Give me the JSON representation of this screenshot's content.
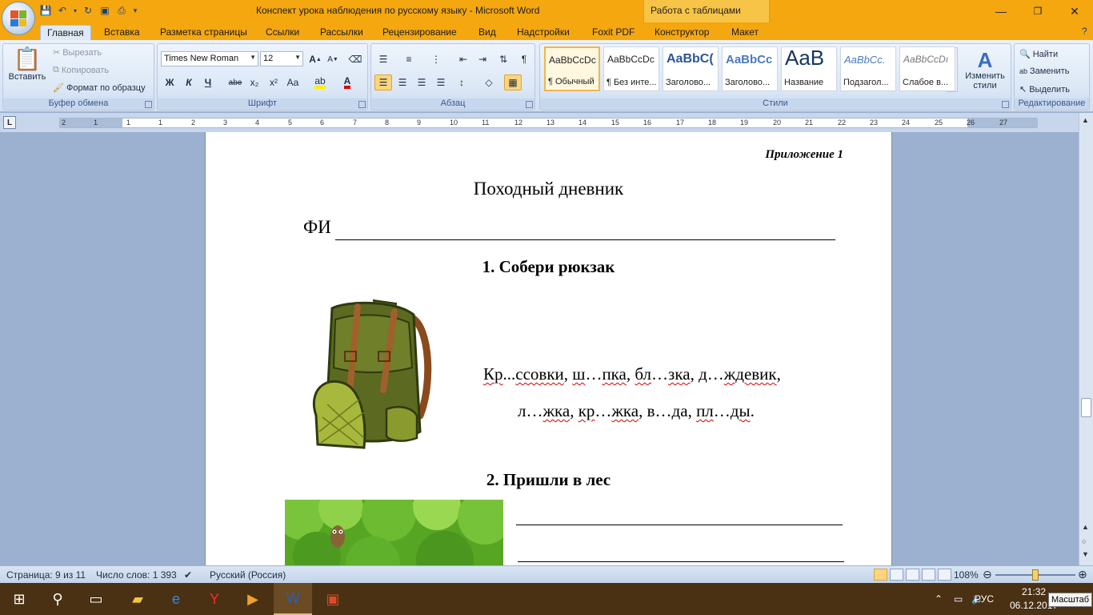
{
  "window": {
    "title": "Конспект урока наблюдения по русскому языку - Microsoft Word",
    "context_tab": "Работа с таблицами",
    "minimize": "—",
    "restore": "❐",
    "close": "✕"
  },
  "tabs": [
    "Главная",
    "Вставка",
    "Разметка страницы",
    "Ссылки",
    "Рассылки",
    "Рецензирование",
    "Вид",
    "Надстройки",
    "Foxit PDF",
    "Конструктор",
    "Макет"
  ],
  "ribbon": {
    "clipboard": {
      "label": "Буфер обмена",
      "paste": "Вставить",
      "cut": "Вырезать",
      "copy": "Копировать",
      "format_painter": "Формат по образцу"
    },
    "font": {
      "label": "Шрифт",
      "family": "Times New Roman",
      "size": "12",
      "bold": "Ж",
      "italic": "К",
      "underline": "Ч",
      "strike": "abe",
      "sub": "x₂",
      "sup": "x²",
      "case": "Aa"
    },
    "paragraph": {
      "label": "Абзац"
    },
    "styles": {
      "label": "Стили",
      "items": [
        {
          "sample": "AaBbCcDc",
          "name": "¶ Обычный"
        },
        {
          "sample": "AaBbCcDc",
          "name": "¶ Без инте..."
        },
        {
          "sample": "AaBbC(",
          "name": "Заголово..."
        },
        {
          "sample": "AaBbCc",
          "name": "Заголово..."
        },
        {
          "sample": "AaB",
          "name": "Название"
        },
        {
          "sample": "AaBbCc.",
          "name": "Подзагол..."
        },
        {
          "sample": "AaBbCcDı",
          "name": "Слабое в..."
        }
      ],
      "change_styles": "Изменить стили"
    },
    "editing": {
      "label": "Редактирование",
      "find": "Найти",
      "replace": "Заменить",
      "select": "Выделить"
    }
  },
  "ruler": {
    "numbers": [
      "2",
      "1",
      "1",
      "1",
      "2",
      "3",
      "4",
      "5",
      "6",
      "7",
      "8",
      "9",
      "10",
      "11",
      "12",
      "13",
      "14",
      "15",
      "16",
      "17",
      "18",
      "19",
      "20",
      "21",
      "22",
      "23",
      "24",
      "25",
      "26",
      "27"
    ]
  },
  "document": {
    "appendix": "Приложение 1",
    "title": "Походный дневник",
    "fi_label": "ФИ",
    "task1": "1. Собери рюкзак",
    "words_line1": [
      {
        "t": "Кр",
        "s": true
      },
      {
        "t": "...",
        "s": false
      },
      {
        "t": "ссовки",
        "s": true
      },
      {
        "t": ", ",
        "s": false
      },
      {
        "t": "ш",
        "s": true
      },
      {
        "t": "…",
        "s": false
      },
      {
        "t": "пка",
        "s": true
      },
      {
        "t": ", ",
        "s": false
      },
      {
        "t": "бл",
        "s": true
      },
      {
        "t": "…",
        "s": false
      },
      {
        "t": "зка",
        "s": true
      },
      {
        "t": ", ",
        "s": false
      },
      {
        "t": "д",
        "s": true
      },
      {
        "t": "…",
        "s": false
      },
      {
        "t": "ждевик",
        "s": true
      },
      {
        "t": ",",
        "s": false
      }
    ],
    "words_line2": [
      {
        "t": "л",
        "s": false
      },
      {
        "t": "…",
        "s": false
      },
      {
        "t": "жка",
        "s": true
      },
      {
        "t": ", ",
        "s": false
      },
      {
        "t": "кр",
        "s": true
      },
      {
        "t": "…",
        "s": false
      },
      {
        "t": "жка",
        "s": true
      },
      {
        "t": ", ",
        "s": false
      },
      {
        "t": "в",
        "s": false
      },
      {
        "t": "…",
        "s": false
      },
      {
        "t": "да",
        "s": false
      },
      {
        "t": ", ",
        "s": false
      },
      {
        "t": "пл",
        "s": true
      },
      {
        "t": "…",
        "s": false
      },
      {
        "t": "ды",
        "s": true
      },
      {
        "t": ".",
        "s": false
      }
    ],
    "task2": "2. Пришли в лес"
  },
  "status": {
    "page": "Страница: 9 из 11",
    "words": "Число слов: 1 393",
    "language": "Русский (Россия)",
    "zoom": "108%"
  },
  "taskbar": {
    "language": "РУС",
    "time": "21:32",
    "date": "06.12.2017",
    "tooltip": "Масштаб"
  }
}
